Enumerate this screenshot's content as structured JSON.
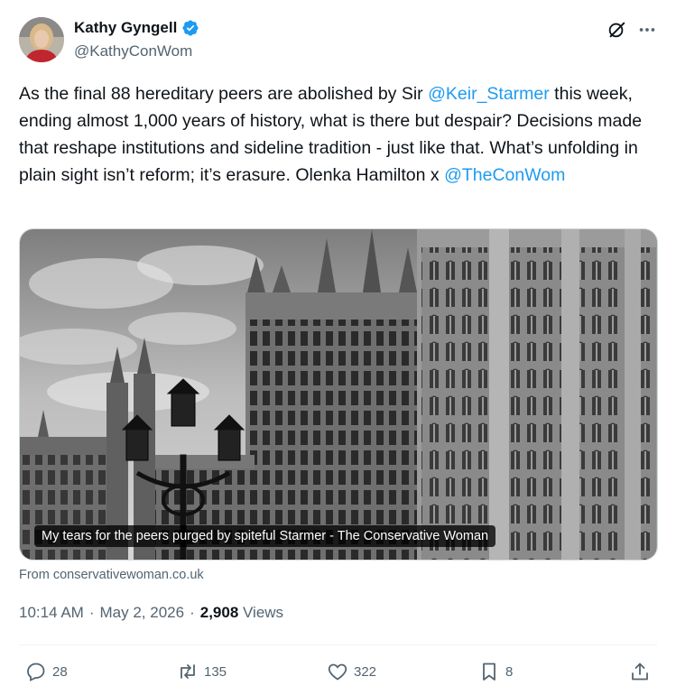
{
  "author": {
    "name": "Kathy Gyngell",
    "handle": "@KathyConWom",
    "verified": true
  },
  "tweet": {
    "text_1": "As the final 88 hereditary peers are abolished by Sir ",
    "mention_1": "@Keir_Starmer",
    "text_2": " this week, ending almost 1,000 years of history, what is there but despair? Decisions made that reshape institutions and sideline tradition - just like that.  What’s unfolding in plain sight isn’t reform; it’s erasure.  Olenka Hamilton x ",
    "mention_2": "@TheConWom"
  },
  "media": {
    "caption": "My tears for the peers purged by spiteful Starmer - The Conservative Woman",
    "source": "From conservativewoman.co.uk"
  },
  "meta": {
    "time": "10:14 AM",
    "separator": "·",
    "date": "May 2, 2026",
    "views_count": "2,908",
    "views_label": "Views"
  },
  "actions": {
    "replies": "28",
    "reposts": "135",
    "likes": "322",
    "bookmarks": "8"
  },
  "icons": [
    "verified-badge-icon",
    "grok-icon",
    "more-icon",
    "reply-icon",
    "repost-icon",
    "like-icon",
    "bookmark-icon",
    "share-icon"
  ],
  "colors": {
    "accent": "#1d9bf0",
    "text": "#0f1419",
    "secondary": "#536471"
  }
}
